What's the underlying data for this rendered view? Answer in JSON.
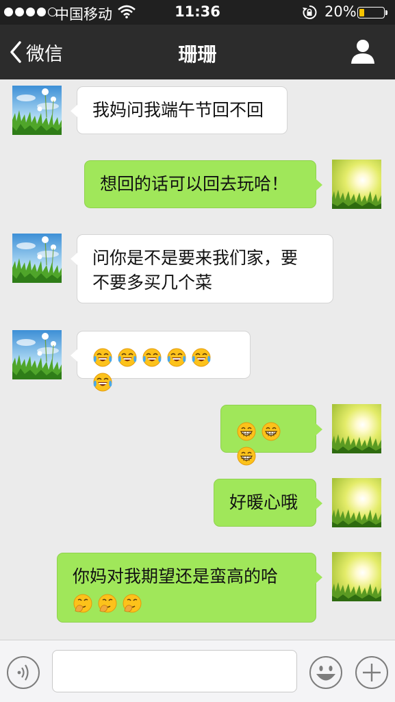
{
  "status_bar": {
    "carrier": "中国移动",
    "time": "11:36",
    "battery": "20%",
    "battery_level": 0.2
  },
  "nav": {
    "back_label": "微信",
    "title": "珊珊"
  },
  "messages": [
    {
      "side": "left",
      "text": "我妈问我端午节回不回"
    },
    {
      "side": "right",
      "text": "想回的话可以回去玩哈！"
    },
    {
      "side": "left",
      "lines": [
        "问你是不是要来我们家，要",
        "不要多买几个菜"
      ]
    },
    {
      "side": "left",
      "emoji": "tears-of-joy-emoji",
      "count": 6
    },
    {
      "side": "right",
      "emoji": "grin-emoji",
      "count": 3
    },
    {
      "side": "right",
      "text": "好暖心哦"
    },
    {
      "side": "right",
      "text": "你妈对我期望还是蛮高的哈",
      "emoji": "facepalm-emoji",
      "count": 3
    }
  ],
  "colors": {
    "left_bubble": "#ffffff",
    "right_bubble": "#a0e75a",
    "chat_background": "#ebebeb",
    "nav_background": "#2c2c2c"
  },
  "icons": {
    "back": "chevron-left-icon",
    "profile": "person-icon",
    "voice": "voice-icon",
    "emoji": "smiley-icon",
    "more": "plus-icon"
  }
}
